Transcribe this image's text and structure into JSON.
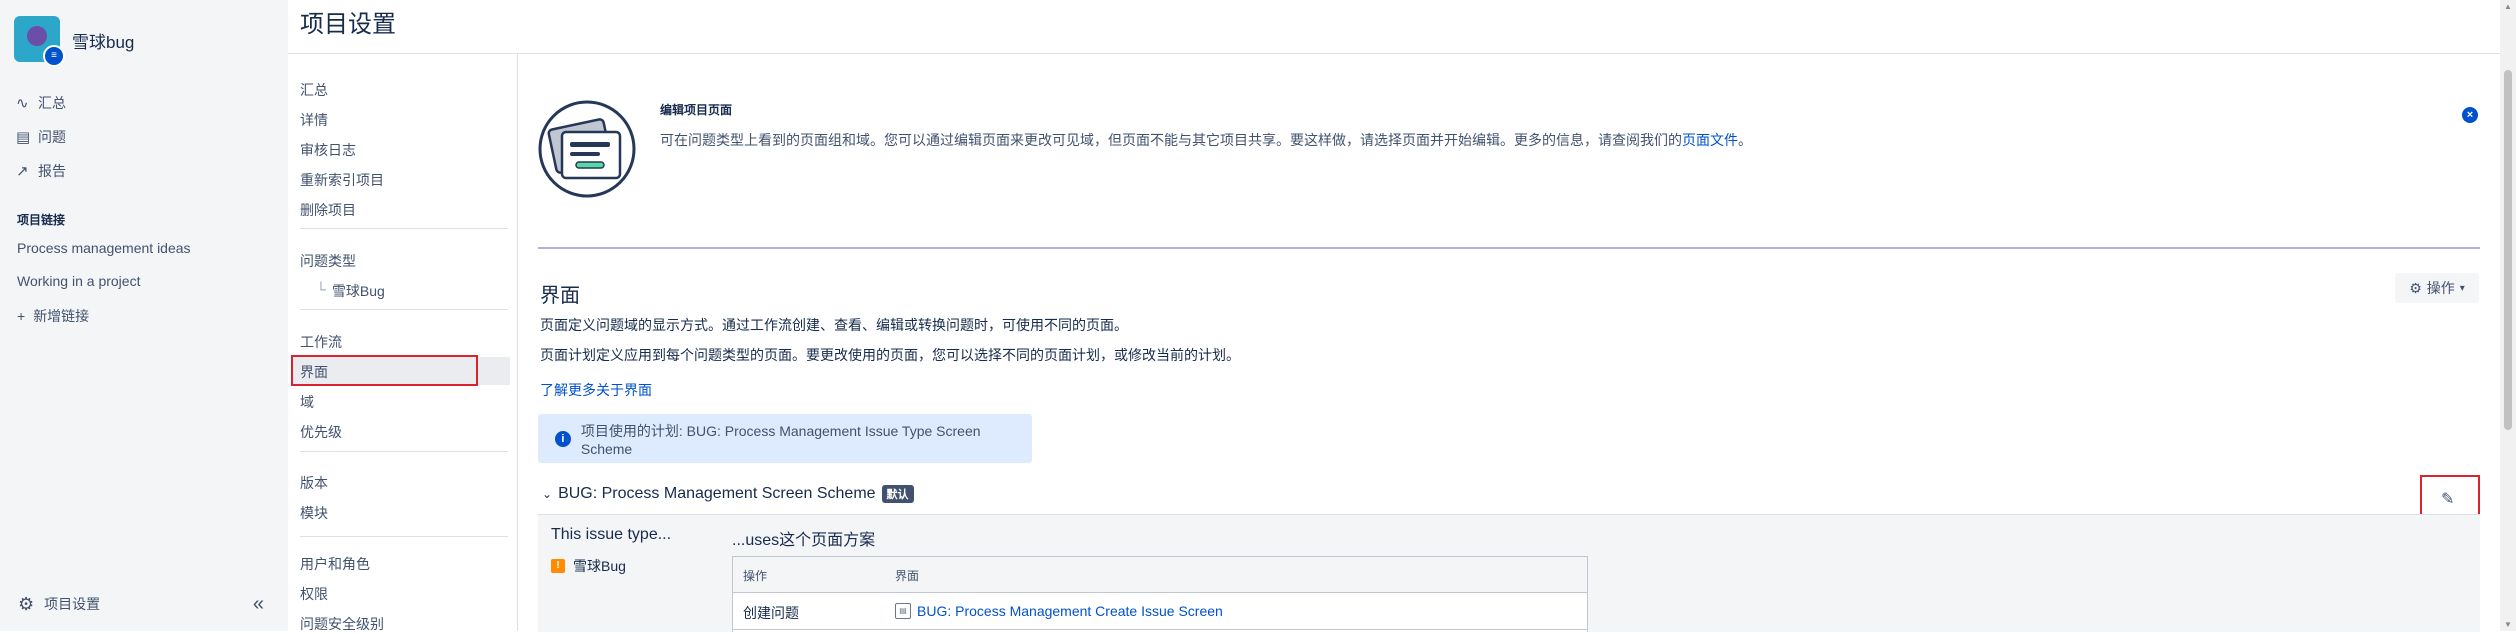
{
  "project": {
    "name": "雪球bug",
    "avatar_badge": "≡"
  },
  "sidebar": {
    "nav": [
      {
        "label": "汇总",
        "icon": "activity-icon"
      },
      {
        "label": "问题",
        "icon": "issues-icon"
      },
      {
        "label": "报告",
        "icon": "chart-icon"
      }
    ],
    "links_title": "项目链接",
    "links": [
      "Process management ideas",
      "Working in a project"
    ],
    "add_link": "新增链接",
    "footer_label": "项目设置",
    "collapse_glyph": "«"
  },
  "page_title": "项目设置",
  "settings_nav": {
    "group1": [
      "汇总",
      "详情",
      "审核日志",
      "重新索引项目",
      "删除项目"
    ],
    "group2_title": "问题类型",
    "group2_sub": "雪球Bug",
    "group3": [
      "工作流",
      "界面",
      "域",
      "优先级"
    ],
    "group4": [
      "版本",
      "模块"
    ],
    "group5": [
      "用户和角色",
      "权限",
      "问题安全级别"
    ]
  },
  "info": {
    "heading": "编辑项目页面",
    "text": "可在问题类型上看到的页面组和域。您可以通过编辑页面来更改可见域，但页面不能与其它项目共享。要这样做，请选择页面并开始编辑。更多的信息，请查阅我们的",
    "link": "页面文件",
    "text_end": "。"
  },
  "section": {
    "title": "界面",
    "ops_button": "操作",
    "desc1": "页面定义问题域的显示方式。通过工作流创建、查看、编辑或转换问题时，可使用不同的页面。",
    "desc2": "页面计划定义应用到每个问题类型的页面。要更改使用的页面，您可以选择不同的页面计划，或修改当前的计划。",
    "learn_more": "了解更多关于界面",
    "scheme_notice": "项目使用的计划: BUG: Process Management Issue Type Screen Scheme"
  },
  "scheme": {
    "title": "BUG: Process Management Screen Scheme",
    "tag": "默认",
    "col_left": "This issue type...",
    "col_right": "...uses这个页面方案",
    "issue_type": "雪球Bug",
    "table_head": {
      "operation": "操作",
      "screen": "界面"
    },
    "rows": [
      {
        "operation": "创建问题",
        "screen": "BUG: Process Management Create Issue Screen"
      }
    ]
  },
  "colors": {
    "accent": "#0052cc",
    "highlight_border": "#d9232e",
    "info_bg": "#deebff",
    "divider": "#b3b0d9"
  }
}
